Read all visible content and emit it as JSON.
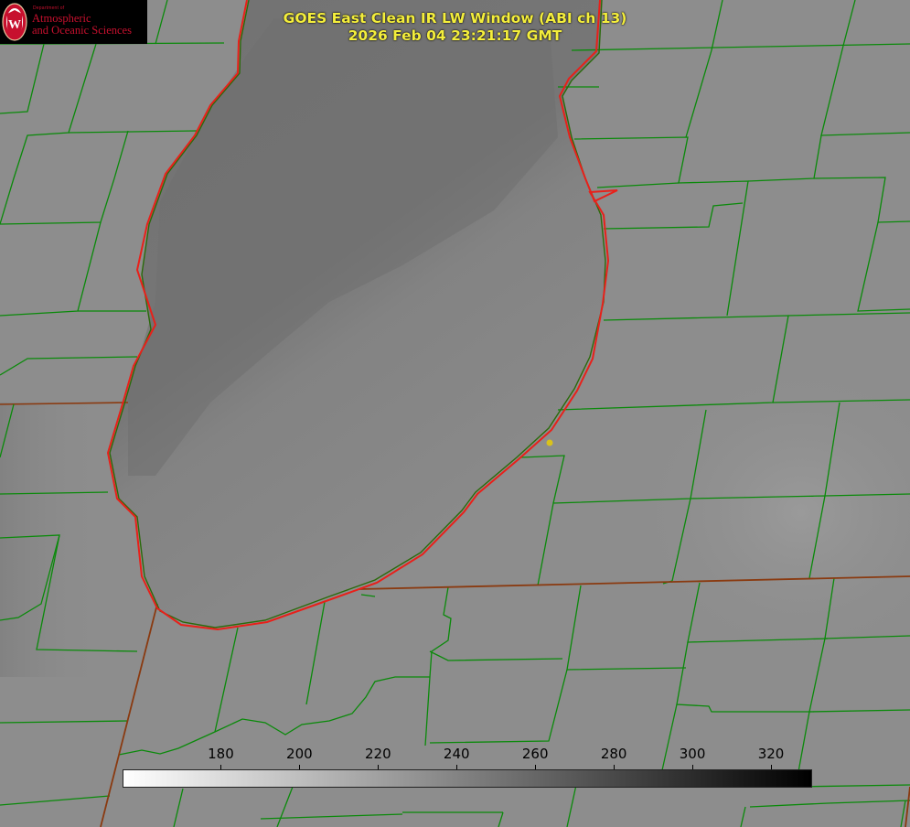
{
  "title": {
    "line1": "GOES East Clean IR LW Window (ABI ch 13)",
    "line2": "2026 Feb 04 23:21:17 GMT"
  },
  "logo": {
    "dept_small": "Department of",
    "line1": "Atmospheric",
    "line2": "and Oceanic Sciences",
    "seal_letter": "W"
  },
  "colorbar": {
    "min_value": 155,
    "max_value": 330,
    "ticks": [
      "180",
      "200",
      "220",
      "240",
      "260",
      "280",
      "300",
      "320"
    ],
    "color_low": "#ffffff",
    "color_high": "#000000"
  },
  "colors": {
    "county_border": "#0a8a0a",
    "state_border": "#8a3a10",
    "lake_shoreline": "#e8201a",
    "marker": "#d9c21a",
    "title_text": "#f4ee3c",
    "logo_red": "#c7102e"
  },
  "map": {
    "marker_icon": "location-dot-icon"
  }
}
